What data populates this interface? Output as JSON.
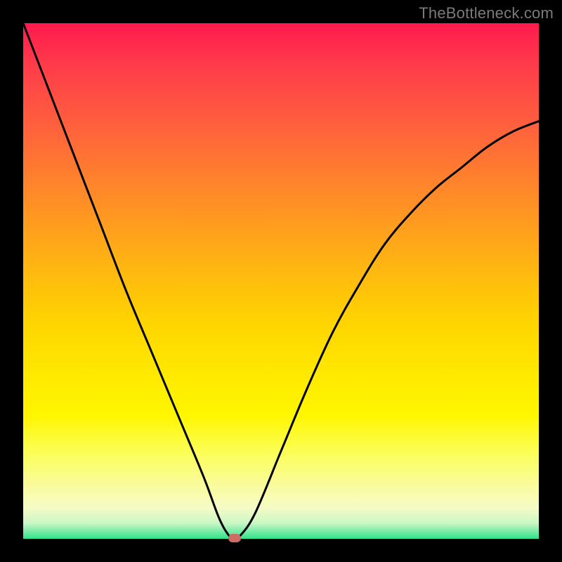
{
  "watermark": "TheBottleneck.com",
  "colors": {
    "frame": "#000000",
    "gradient_top": "#ff1a4d",
    "gradient_bottom": "#2fe38a",
    "curve": "#000000",
    "marker": "#cf6b64"
  },
  "chart_data": {
    "type": "line",
    "title": "",
    "xlabel": "",
    "ylabel": "",
    "xlim": [
      0,
      100
    ],
    "ylim": [
      0,
      100
    ],
    "series": [
      {
        "name": "bottleneck-curve",
        "x": [
          0,
          5,
          10,
          15,
          20,
          25,
          30,
          35,
          38,
          40,
          41,
          42,
          45,
          50,
          55,
          60,
          65,
          70,
          75,
          80,
          85,
          90,
          95,
          100
        ],
        "values": [
          100,
          87,
          74,
          61,
          48,
          36,
          24,
          12,
          4,
          0.5,
          0,
          0.5,
          5,
          17,
          29,
          40,
          49,
          57,
          63,
          68,
          72,
          76,
          79,
          81
        ]
      }
    ],
    "marker": {
      "x": 41,
      "y": 0
    }
  }
}
